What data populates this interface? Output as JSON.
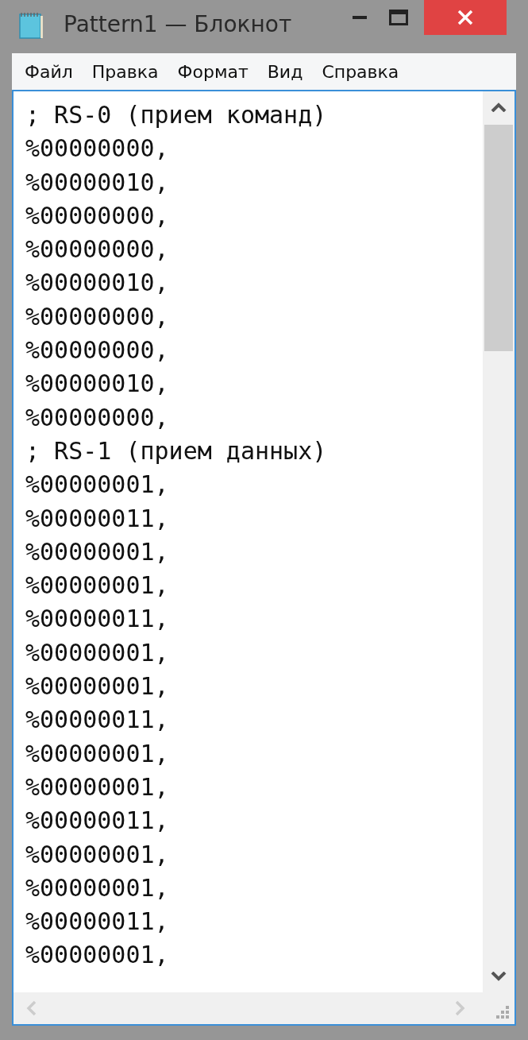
{
  "window": {
    "title": "Pattern1 — Блокнот"
  },
  "menu": [
    "Файл",
    "Правка",
    "Формат",
    "Вид",
    "Справка"
  ],
  "editor": {
    "lines": [
      "; RS-0 (прием команд)",
      "%00000000,",
      "%00000010,",
      "%00000000,",
      "%00000000,",
      "%00000010,",
      "%00000000,",
      "%00000000,",
      "%00000010,",
      "%00000000,",
      "; RS-1 (прием данных)",
      "%00000001,",
      "%00000011,",
      "%00000001,",
      "%00000001,",
      "%00000011,",
      "%00000001,",
      "%00000001,",
      "%00000011,",
      "%00000001,",
      "%00000001,",
      "%00000011,",
      "%00000001,",
      "%00000001,",
      "%00000011,",
      "%00000001,"
    ]
  }
}
